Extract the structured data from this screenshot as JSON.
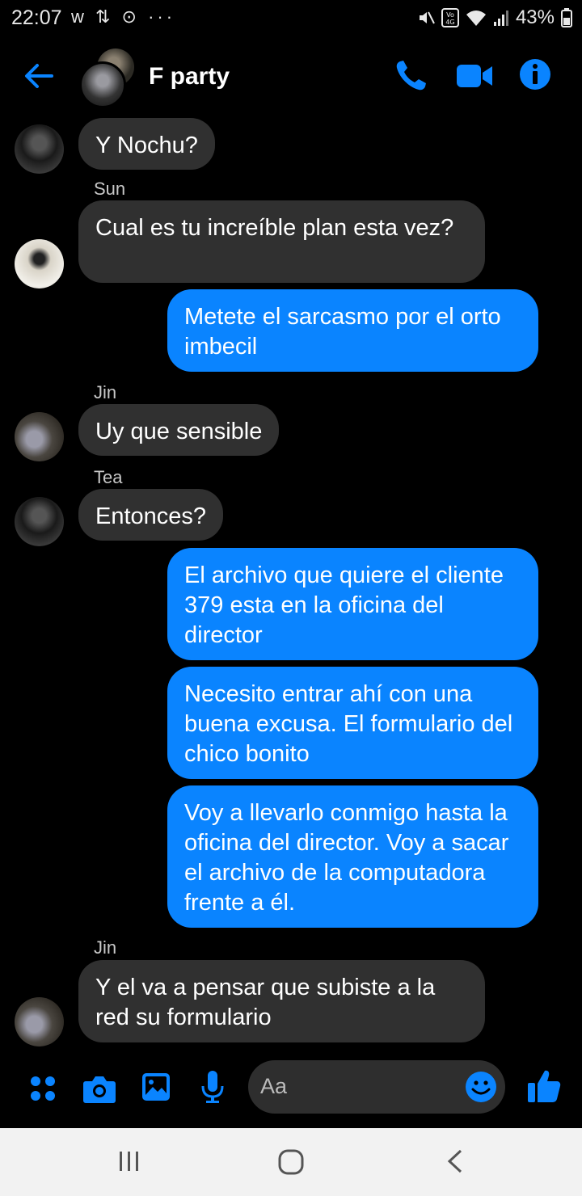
{
  "status": {
    "time": "22:07",
    "app_icons": "w ⇅ ⊙ ···",
    "battery": "43%"
  },
  "header": {
    "title": "F party"
  },
  "messages": [
    {
      "dir": "in",
      "text": "Y Nochu?"
    },
    {
      "dir": "in",
      "sender": "Sun",
      "text": "Cual es tu increíble plan esta vez?"
    },
    {
      "dir": "out",
      "text": "Metete el sarcasmo por el orto imbecil"
    },
    {
      "dir": "in",
      "sender": "Jin",
      "text": "Uy que sensible"
    },
    {
      "dir": "in",
      "sender": "Tea",
      "text": "Entonces?"
    },
    {
      "dir": "out",
      "text": "El archivo que quiere el cliente 379 esta en la oficina del director"
    },
    {
      "dir": "out",
      "text": "Necesito entrar ahí con una buena excusa. El formulario del chico bonito"
    },
    {
      "dir": "out",
      "text": "Voy a llevarlo conmigo hasta la oficina del director. Voy a sacar el archivo de la computadora frente a él."
    },
    {
      "dir": "in",
      "sender": "Jin",
      "text": "Y el va a pensar que subiste a la red su formulario"
    }
  ],
  "composer": {
    "placeholder": "Aa"
  },
  "colors": {
    "accent": "#0a84ff",
    "incoming_bubble": "#303030",
    "background": "#000000"
  },
  "icons": [
    "back-arrow-icon",
    "phone-icon",
    "video-icon",
    "info-icon",
    "apps-icon",
    "camera-icon",
    "gallery-icon",
    "mic-icon",
    "emoji-icon",
    "thumbs-up-icon",
    "recent-apps-icon",
    "home-icon",
    "nav-back-icon"
  ]
}
